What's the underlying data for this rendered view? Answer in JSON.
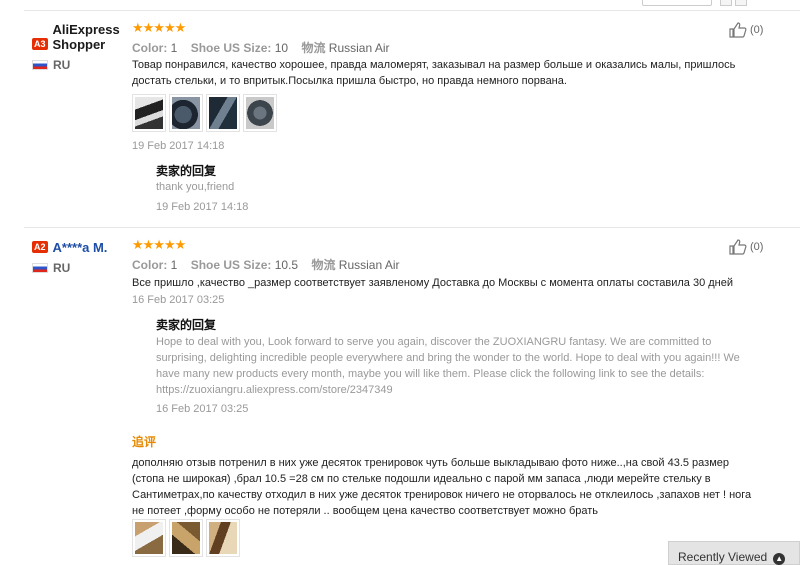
{
  "reviews": [
    {
      "level": "A3",
      "name": "AliExpress Shopper",
      "country": "RU",
      "stars": "★★★★★",
      "color_label": "Color:",
      "color_value": "1",
      "size_label": "Shoe US Size:",
      "size_value": "10",
      "ship_label": "物流",
      "ship_value": "Russian Air",
      "feedback": "Товар понравился, качество хорошее, правда маломерят, заказывал на размер больше и оказались малы, пришлось достать стельки, и то впритык.Посылка пришла быстро, но правда немного порвана.",
      "date": "19 Feb 2017 14:18",
      "reply_title": "卖家的回复",
      "reply_text": "thank you,friend",
      "reply_date": "19 Feb 2017 14:18",
      "helpful_count": "(0)"
    },
    {
      "level": "A2",
      "name": "A****a M.",
      "country": "RU",
      "stars": "★★★★★",
      "color_label": "Color:",
      "color_value": "1",
      "size_label": "Shoe US Size:",
      "size_value": "10.5",
      "ship_label": "物流",
      "ship_value": "Russian Air",
      "feedback": "Все пришло ,качество _размер соответствует заявленому Доставка до Москвы с момента оплаты составила 30 дней",
      "date": "16 Feb 2017 03:25",
      "reply_title": "卖家的回复",
      "reply_text": "Hope to deal with you, Look forward to serve you again, discover the ZUOXIANGRU fantasy. We are committed to surprising, delighting incredible people everywhere and bring the wonder to the world. Hope to deal with you again!!! We have many new products every month, maybe you will like them. Please click the following link to see the details: https://zuoxiangru.aliexpress.com/store/2347349",
      "reply_date": "16 Feb 2017 03:25",
      "helpful_count": "(0)",
      "additional_title": "追评",
      "additional_text": "дополняю отзыв потренил в них уже десяток тренировок чуть больше выкладываю фото ниже..,на свой 43.5 размер (стопа не широкая) ,брал 10.5 =28 см по стельке подошли идеально с парой мм запаса ,люди мерейте стельку в Сантиметрах,по качеству отходил в них уже десяток тренировок ничего не оторвалось не отклеилось ,запахов нет ! нога не потеет ,форму особо не потеряли .. вообщем цена качество соответствует можно брать"
    }
  ],
  "recently_viewed": "Recently Viewed",
  "colors": {
    "level_badge": "#e62e04",
    "stars": "#ff9a00",
    "additional_title": "#e68a00",
    "buyer_link": "#1d4ea6"
  }
}
